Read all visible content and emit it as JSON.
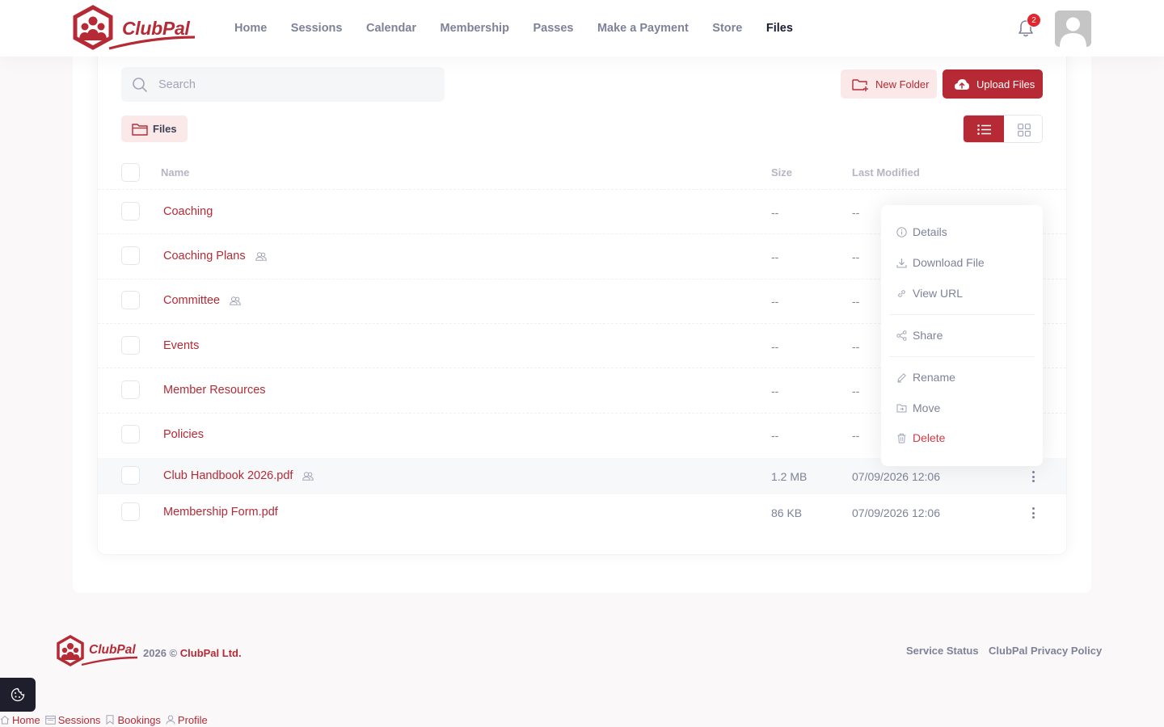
{
  "brand": {
    "logo_text": "ClubPal",
    "accent": "#b62a35",
    "icon": "clubpal-logo-icon"
  },
  "nav": {
    "items": [
      {
        "label": "Home",
        "active": false
      },
      {
        "label": "Sessions",
        "active": false
      },
      {
        "label": "Calendar",
        "active": false
      },
      {
        "label": "Membership",
        "active": false
      },
      {
        "label": "Passes",
        "active": false
      },
      {
        "label": "Make a Payment",
        "active": false
      },
      {
        "label": "Store",
        "active": false
      },
      {
        "label": "Files",
        "active": true
      }
    ]
  },
  "notifications": {
    "count": "2",
    "icon": "bell-icon"
  },
  "toolbar": {
    "search_placeholder": "Search",
    "new_folder_label": "New Folder",
    "upload_label": "Upload Files"
  },
  "breadcrumb": {
    "label": "Files",
    "icon": "folder-icon"
  },
  "view": {
    "mode": "list"
  },
  "table": {
    "headers": {
      "name": "Name",
      "size": "Size",
      "modified": "Last Modified"
    },
    "rows": [
      {
        "name": "Coaching",
        "shared": false,
        "size": "--",
        "modified": "--"
      },
      {
        "name": "Coaching Plans",
        "shared": true,
        "size": "--",
        "modified": "--"
      },
      {
        "name": "Committee",
        "shared": true,
        "size": "--",
        "modified": "--"
      },
      {
        "name": "Events",
        "shared": false,
        "size": "--",
        "modified": "--"
      },
      {
        "name": "Member Resources",
        "shared": false,
        "size": "--",
        "modified": "--"
      },
      {
        "name": "Policies",
        "shared": false,
        "size": "--",
        "modified": "--"
      },
      {
        "name": "Club Handbook 2026.pdf",
        "shared": true,
        "size": "1.2 MB",
        "modified": "07/09/2026 12:06"
      },
      {
        "name": "Membership Form.pdf",
        "shared": false,
        "size": "86 KB",
        "modified": "07/09/2026 12:06"
      }
    ]
  },
  "context_menu": {
    "items": [
      {
        "label": "Details",
        "icon": "info-icon"
      },
      {
        "label": "Download File",
        "icon": "download-icon"
      },
      {
        "label": "View URL",
        "icon": "link-icon"
      },
      {
        "label": "Share",
        "icon": "share-icon"
      },
      {
        "label": "Rename",
        "icon": "pencil-icon"
      },
      {
        "label": "Move",
        "icon": "move-icon"
      },
      {
        "label": "Delete",
        "icon": "trash-icon"
      }
    ]
  },
  "footer": {
    "logo_text": "ClubPal",
    "year": "2026 ©",
    "company": "ClubPal Ltd.",
    "links": [
      "Service Status",
      "ClubPal Privacy Policy"
    ]
  },
  "bottom_nav": {
    "items": [
      {
        "label": "Home",
        "icon": "home-icon"
      },
      {
        "label": "Sessions",
        "icon": "calendar-icon"
      },
      {
        "label": "Bookings",
        "icon": "bookmark-icon"
      },
      {
        "label": "Profile",
        "icon": "user-icon"
      }
    ]
  }
}
